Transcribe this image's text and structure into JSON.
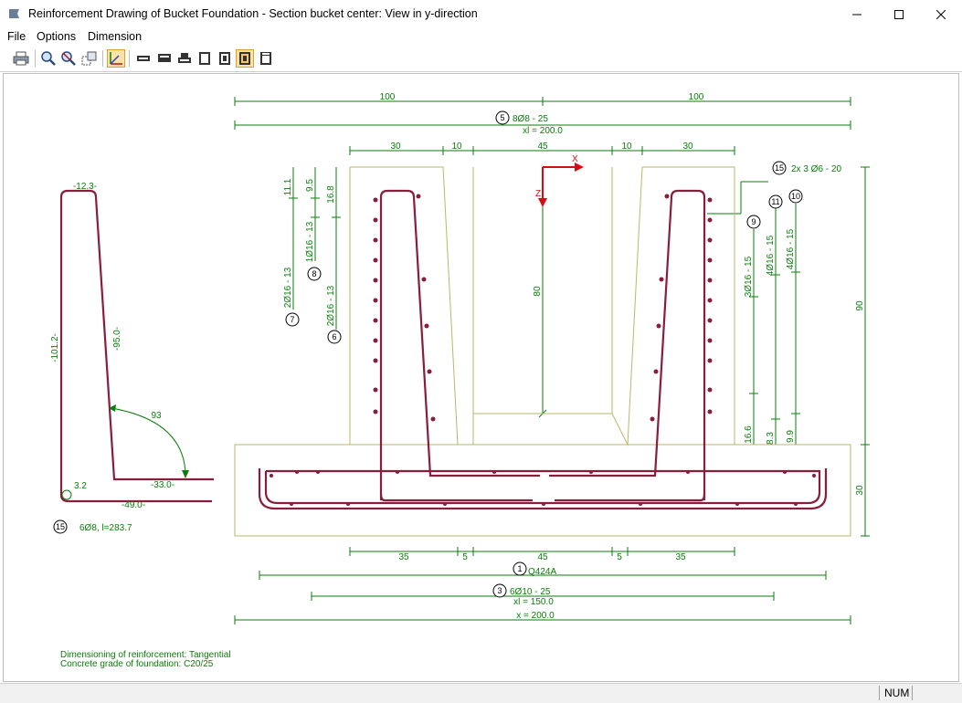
{
  "window": {
    "title": "Reinforcement Drawing of Bucket Foundation - Section bucket center: View in y-direction"
  },
  "menu": {
    "file": "File",
    "options": "Options",
    "dimension": "Dimension"
  },
  "toolbar": {
    "icons": [
      "print-icon",
      "zoom-in-icon",
      "zoom-out-icon",
      "zoom-fit-icon",
      "axes-icon",
      "view-1-icon",
      "view-2-icon",
      "view-3-icon",
      "view-4-icon",
      "view-5-icon",
      "view-6-icon",
      "view-7-icon"
    ]
  },
  "status": {
    "num": "NUM"
  },
  "colors": {
    "dim_green": "#0a7d0a",
    "bar_red": "#8a1c3c",
    "outline": "#b8b86a",
    "axis_red": "#d01010"
  },
  "drawing": {
    "bend": {
      "top": "-12.3-",
      "left": "-101.2-",
      "diag": "-95.0-",
      "angle": "93",
      "right": "-33.0-",
      "bottom": "-49.0-",
      "radius": "3.2",
      "mark_no": "15",
      "mark_text": "6Ø8, l=283.7"
    },
    "top_dims": {
      "d1": "100",
      "d2": "100",
      "mark5_no": "5",
      "mark5_text": "8Ø8 - 25",
      "xl": "xl = 200.0",
      "w1": "30",
      "w2": "10",
      "w3": "45",
      "w4": "10",
      "w5": "30"
    },
    "left_dims": {
      "v1": "11.1",
      "v2": "9.5",
      "v3": "16.8",
      "mark7_no": "7",
      "mark7_text": "2Ø16 - 13",
      "mark8_no": "8",
      "mark8_text": "1Ø16 - 13",
      "mark6_no": "6",
      "mark6_text": "2Ø16 - 13"
    },
    "inner": {
      "depth": "80",
      "axis_x": "X",
      "axis_z": "Z"
    },
    "right_dims": {
      "mark15_no": "15",
      "mark15_text": "2x 3 Ø6 - 20",
      "mark11_no": "11",
      "mark10_no": "10",
      "mark9_no": "9",
      "mark9_text": "3Ø16 - 15",
      "mark11_text": "4Ø16 - 15",
      "mark10_text": "4Ø16 - 15",
      "h90": "90",
      "h30": "30",
      "v166": "16.6",
      "v83": "8.3",
      "v99": "9.9"
    },
    "bottom_dims": {
      "b1": "35",
      "b2": "5",
      "b3": "45",
      "b4": "5",
      "b5": "35",
      "mark1_no": "1",
      "mark1_text": "Q424A",
      "mark3_no": "3",
      "mark3_text": "6Ø10 - 25",
      "xl": "xl = 150.0",
      "x": "x = 200.0"
    },
    "notes": {
      "line1": "Dimensioning  of  reinforcement: Tangential",
      "line2": "Concrete grade of foundation:  C20/25"
    }
  }
}
